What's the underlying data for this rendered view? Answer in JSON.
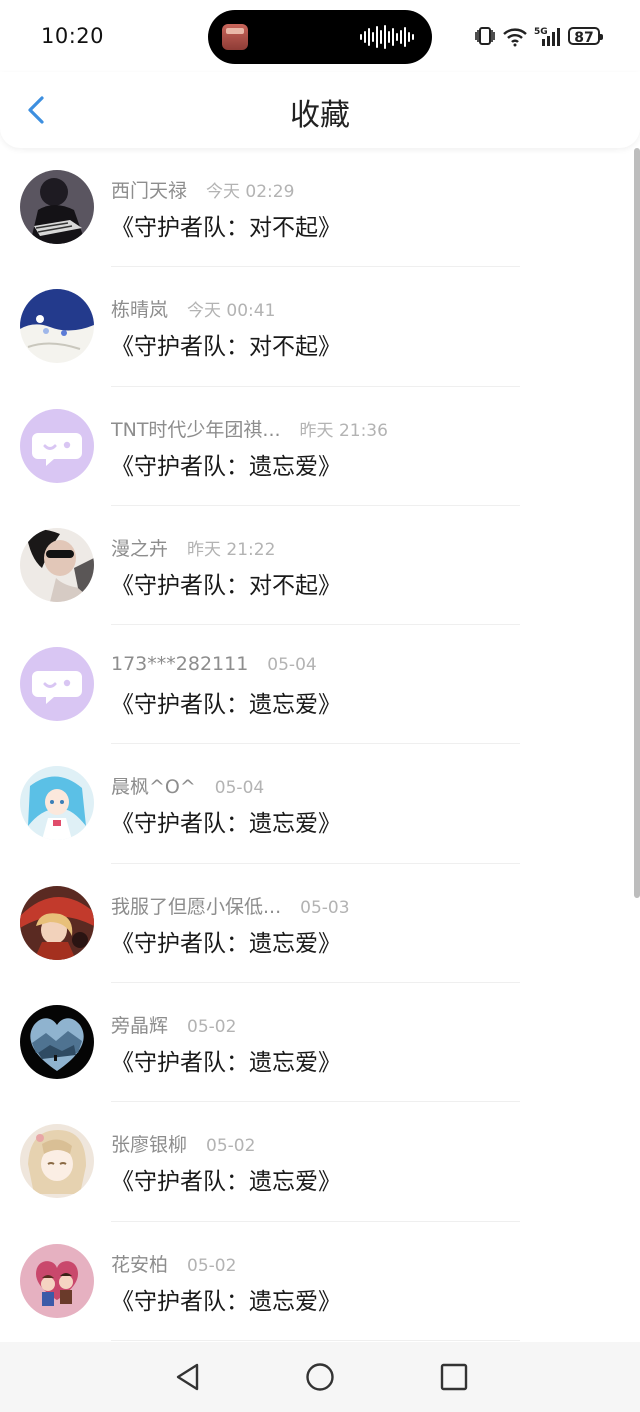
{
  "status_bar": {
    "time": "10:20",
    "battery": "87"
  },
  "header": {
    "title": "收藏"
  },
  "items": [
    {
      "name": "西门天禄",
      "time": "今天 02:29",
      "song": "《守护者队：对不起》",
      "avatar": "avatar-photo-dark"
    },
    {
      "name": "栋晴岚",
      "time": "今天 00:41",
      "song": "《守护者队：对不起》",
      "avatar": "avatar-blue-sky"
    },
    {
      "name": "TNT时代少年团祺...",
      "time": "昨天 21:36",
      "song": "《守护者队：遗忘爱》",
      "avatar": "avatar-default-chat"
    },
    {
      "name": "漫之卉",
      "time": "昨天 21:22",
      "song": "《守护者队：对不起》",
      "avatar": "avatar-photo-face"
    },
    {
      "name": "173***282111",
      "time": "05-04",
      "song": "《守护者队：遗忘爱》",
      "avatar": "avatar-default-chat"
    },
    {
      "name": "晨枫^O^",
      "time": "05-04",
      "song": "《守护者队：遗忘爱》",
      "avatar": "avatar-anime-blue"
    },
    {
      "name": "我服了但愿小保低...",
      "time": "05-03",
      "song": "《守护者队：遗忘爱》",
      "avatar": "avatar-anime-red"
    },
    {
      "name": "旁晶辉",
      "time": "05-02",
      "song": "《守护者队：遗忘爱》",
      "avatar": "avatar-mountains"
    },
    {
      "name": "张廖银柳",
      "time": "05-02",
      "song": "《守护者队：遗忘爱》",
      "avatar": "avatar-anime-beige"
    },
    {
      "name": "花安柏",
      "time": "05-02",
      "song": "《守护者队：遗忘爱》",
      "avatar": "avatar-cartoon-pink"
    }
  ],
  "colors": {
    "accent": "#3d8fe0",
    "default_avatar_bg": "#d9c6f3",
    "default_avatar_icon": "#ffffff"
  }
}
